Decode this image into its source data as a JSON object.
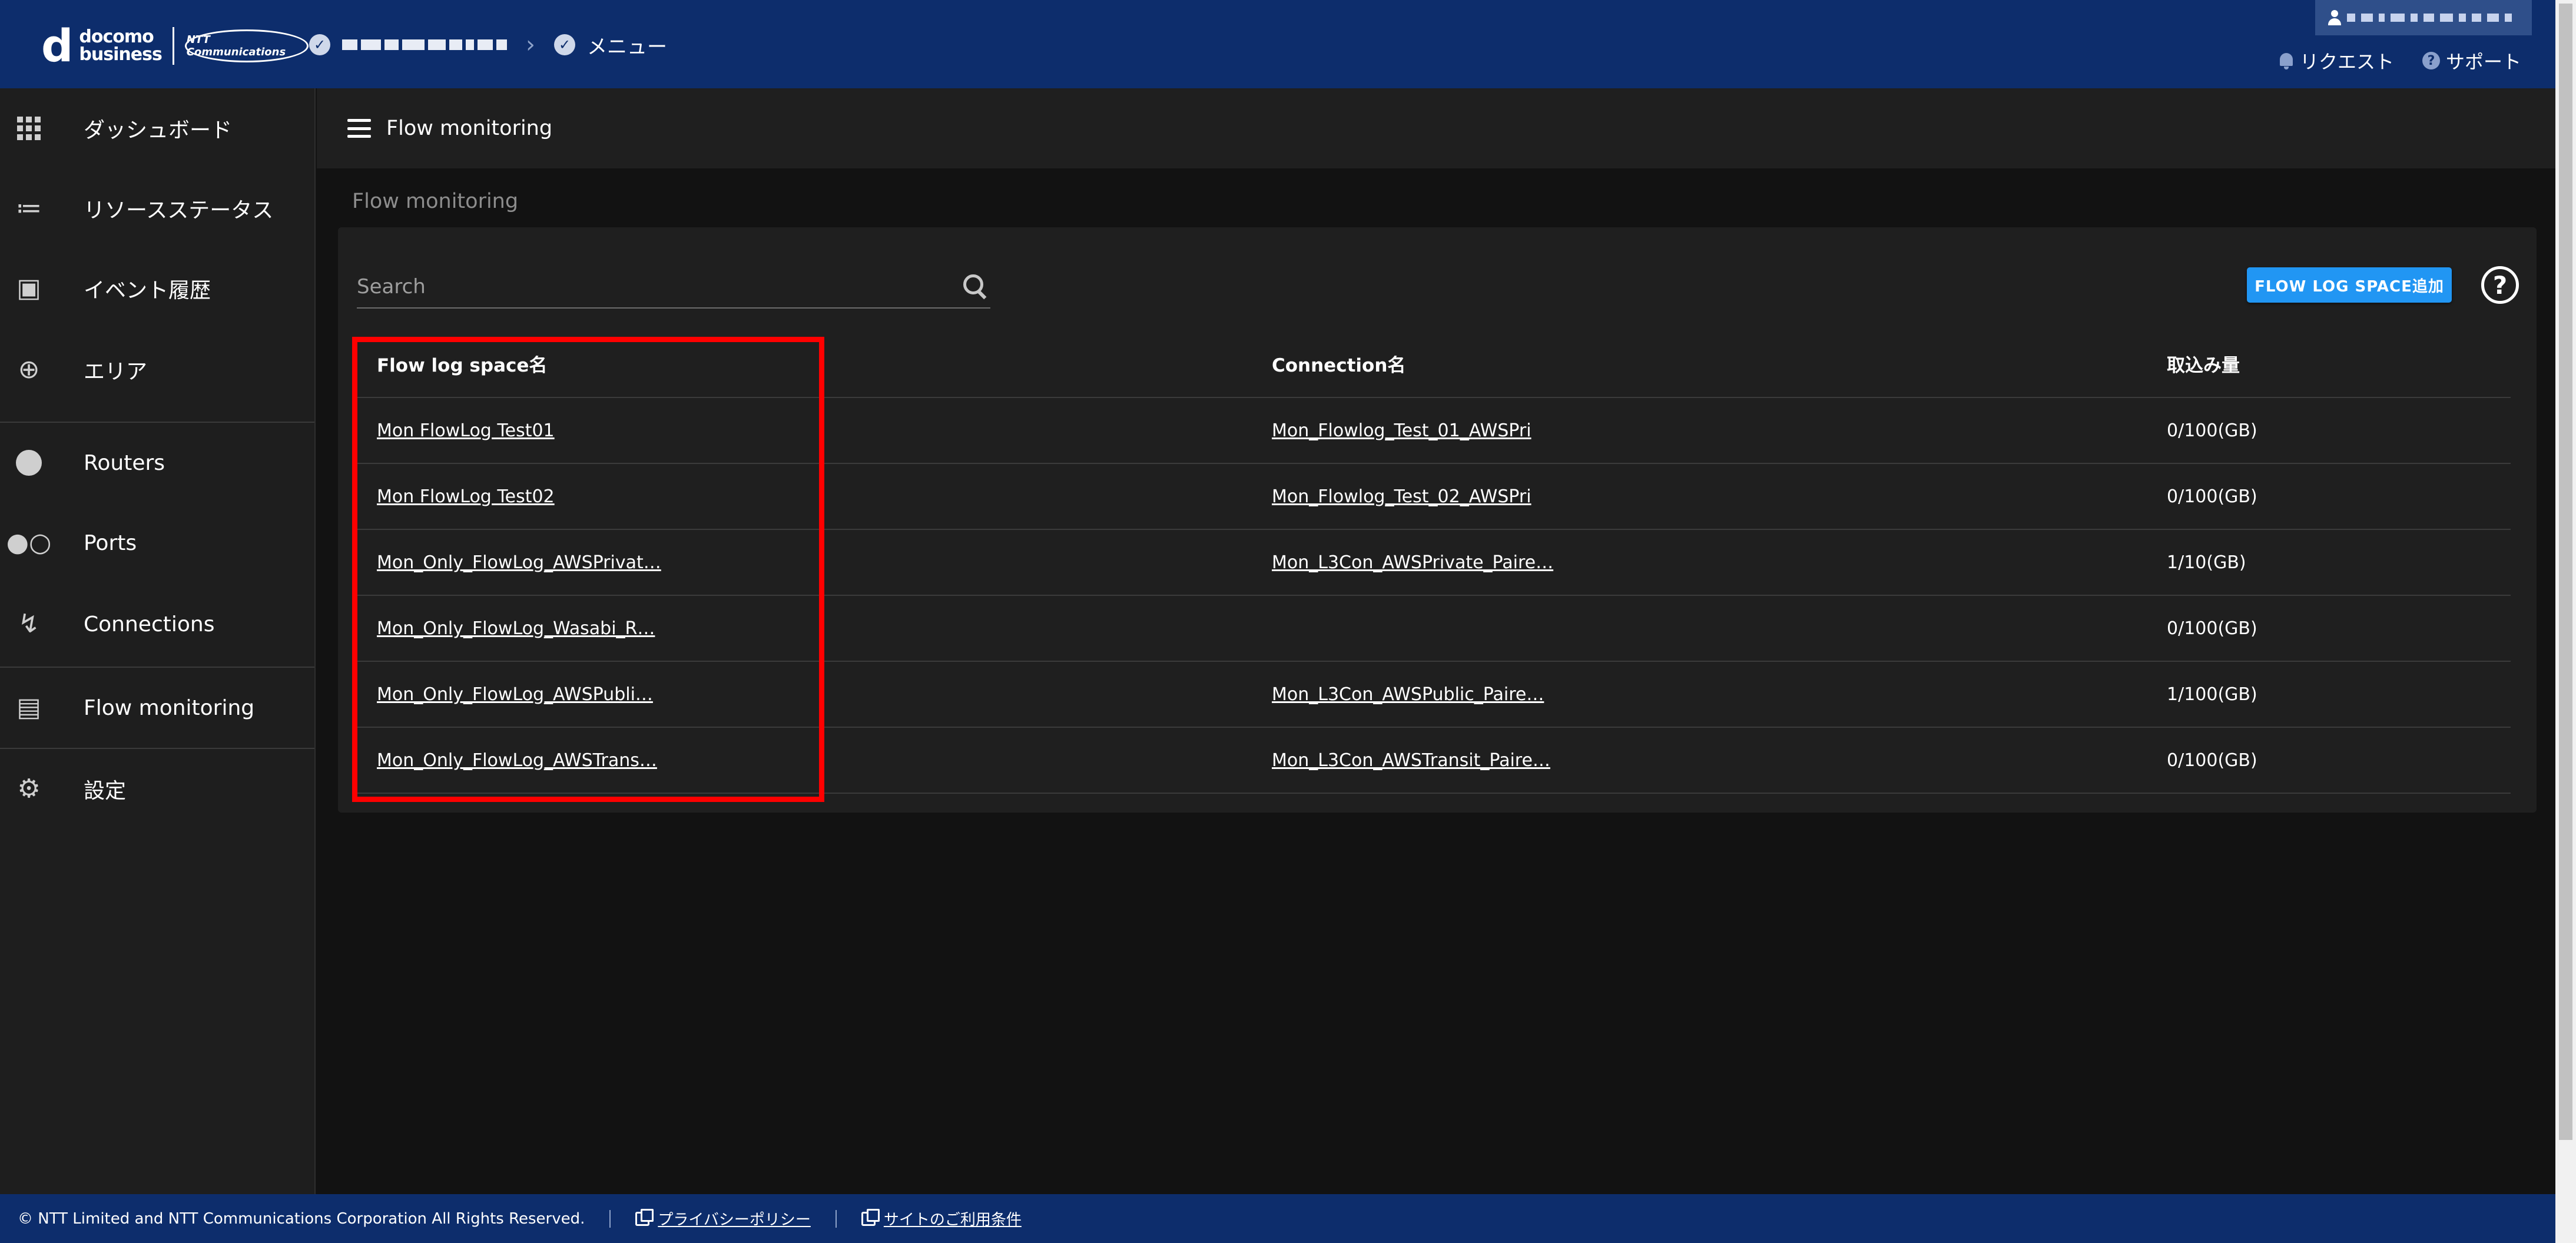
{
  "header": {
    "logo_brand_line1": "docomo",
    "logo_brand_line2": "business",
    "logo_partner": "NTT Communications",
    "menu_label": "メニュー",
    "request_label": "リクエスト",
    "support_label": "サポート"
  },
  "sidebar": {
    "items": [
      {
        "label": "ダッシュボード",
        "icon": "dashboard-grid-icon"
      },
      {
        "label": "リソースステータス",
        "icon": "resource-status-icon"
      },
      {
        "label": "イベント履歴",
        "icon": "event-calendar-icon"
      },
      {
        "label": "エリア",
        "icon": "area-globe-icon"
      },
      {
        "label": "Routers",
        "icon": "router-icon"
      },
      {
        "label": "Ports",
        "icon": "port-icon"
      },
      {
        "label": "Connections",
        "icon": "connection-icon"
      },
      {
        "label": "Flow monitoring",
        "icon": "flow-document-icon"
      },
      {
        "label": "設定",
        "icon": "gear-icon"
      }
    ]
  },
  "topbar": {
    "title": "Flow monitoring"
  },
  "page": {
    "title": "Flow monitoring"
  },
  "toolbar": {
    "search_placeholder": "Search",
    "add_button_label": "FLOW LOG SPACE追加",
    "help_label": "?"
  },
  "table": {
    "headers": [
      "Flow log space名",
      "Connection名",
      "取込み量"
    ],
    "rows": [
      {
        "space": "Mon FlowLog Test01",
        "connection": "Mon_Flowlog_Test_01_AWSPri",
        "usage": "0/100(GB)"
      },
      {
        "space": "Mon FlowLog Test02",
        "connection": "Mon_Flowlog_Test_02_AWSPri",
        "usage": "0/100(GB)"
      },
      {
        "space": "Mon_Only_FlowLog_AWSPrivat…",
        "connection": "Mon_L3Con_AWSPrivate_Paire…",
        "usage": "1/10(GB)"
      },
      {
        "space": "Mon_Only_FlowLog_Wasabi_R…",
        "connection": "",
        "usage": "0/100(GB)"
      },
      {
        "space": "Mon_Only_FlowLog_AWSPubli…",
        "connection": "Mon_L3Con_AWSPublic_Paire…",
        "usage": "1/100(GB)"
      },
      {
        "space": "Mon_Only_FlowLog_AWSTrans…",
        "connection": "Mon_L3Con_AWSTransit_Paire…",
        "usage": "0/100(GB)"
      }
    ]
  },
  "footer": {
    "copyright": "© NTT Limited and NTT Communications Corporation All Rights Reserved.",
    "privacy_label": "プライバシーポリシー",
    "terms_label": "サイトのご利用条件"
  },
  "colors": {
    "header_bg": "#0d2d6c",
    "accent_button": "#2196f3",
    "highlight_border": "#ff0000",
    "sidebar_bg": "#1e1e1e",
    "card_bg": "#1f1f1f"
  }
}
